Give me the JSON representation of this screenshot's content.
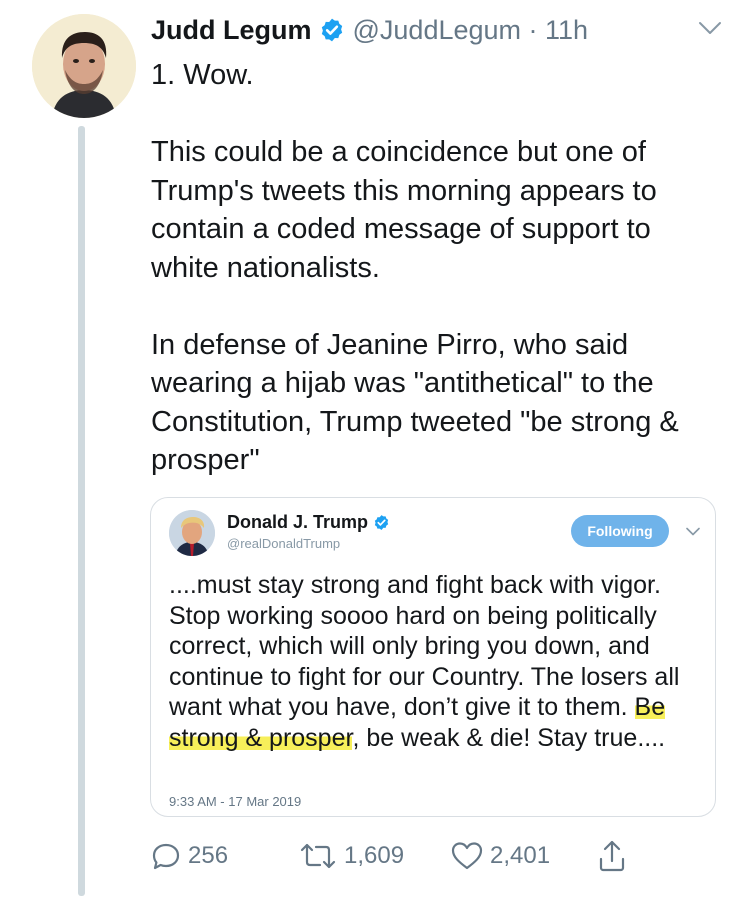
{
  "tweet": {
    "author_name": "Judd Legum",
    "handle_time": "@JuddLegum · 11h",
    "paragraphs": [
      "1. Wow.",
      "This could be a coincidence but one of Trump's tweets this morning appears to contain a coded message of support to white nationalists.",
      "In defense of Jeanine Pirro, who said wearing a hijab was \"antithetical\" to the Constitution, Trump tweeted \"be strong & prosper\""
    ]
  },
  "quoted": {
    "name": "Donald J. Trump",
    "handle": "@realDonaldTrump",
    "follow_label": "Following",
    "text_before": "....must stay strong and fight back with vigor. Stop working soooo hard on being politically correct, which will only bring you down, and continue to fight for our Country. The losers all want what you have, don’t give it to them. ",
    "text_highlight": "Be strong & prosper",
    "text_after": ", be weak & die! Stay true....",
    "timestamp": "9:33 AM - 17 Mar 2019"
  },
  "actions": {
    "replies": "256",
    "retweets": "1,609",
    "likes": "2,401"
  },
  "colors": {
    "verified": "#1da1f2",
    "highlight": "#f7ef5a",
    "follow_button": "#6fb3ea",
    "muted": "#657786"
  },
  "icons": [
    "verified-icon",
    "chevron-down-icon",
    "reply-icon",
    "retweet-icon",
    "like-icon",
    "share-icon"
  ]
}
